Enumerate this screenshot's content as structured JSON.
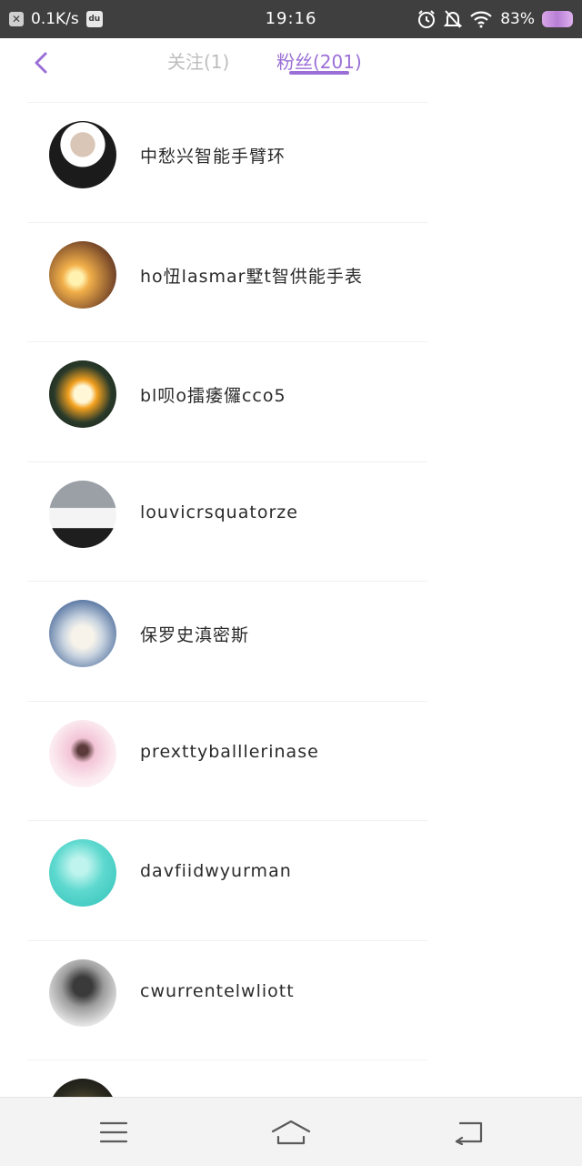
{
  "status_bar": {
    "speed": "0.1K/s",
    "time": "19:16",
    "battery": "83%",
    "left_icon": "x-app-icon",
    "second_icon": "du-app-icon"
  },
  "header": {
    "back_icon": "chevron-left-icon",
    "tabs": [
      {
        "label": "关注(1)",
        "active": false
      },
      {
        "label": "粉丝(201)",
        "active": true
      }
    ],
    "accent_color": "#9b6fd6"
  },
  "followers": [
    {
      "name": "中愁兴智能手臂环"
    },
    {
      "name": "ho忸lasmar墅t智供能手表"
    },
    {
      "name": "bl呗o擂痿儸cco5"
    },
    {
      "name": "louvicrsquatorze"
    },
    {
      "name": "保罗史滇密斯"
    },
    {
      "name": "prexttyballlerinase"
    },
    {
      "name": "davfiidwyurman"
    },
    {
      "name": "cwurrentelwliott"
    },
    {
      "name": ""
    }
  ],
  "nav_bar": {
    "menu_icon": "menu-icon",
    "home_icon": "home-icon",
    "back_icon": "back-icon"
  }
}
